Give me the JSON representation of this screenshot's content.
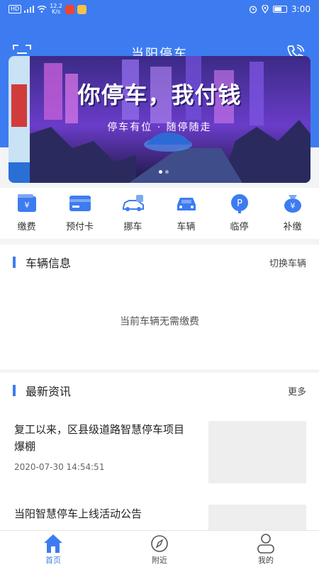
{
  "status_bar": {
    "network_chip": "HD",
    "speed_value": "12.2",
    "speed_unit": "K/s",
    "time": "3:00"
  },
  "header": {
    "title": "当阳停车"
  },
  "banner": {
    "headline": "你停车，我付钱",
    "subline": "停车有位 · 随停随走"
  },
  "quick_actions": [
    {
      "label": "缴费",
      "icon": "wallet-icon"
    },
    {
      "label": "预付卡",
      "icon": "card-icon"
    },
    {
      "label": "挪车",
      "icon": "move-car-icon"
    },
    {
      "label": "车辆",
      "icon": "car-icon"
    },
    {
      "label": "临停",
      "icon": "parking-icon"
    },
    {
      "label": "补缴",
      "icon": "money-bag-icon"
    }
  ],
  "vehicle_card": {
    "title": "车辆信息",
    "switch_label": "切换车辆",
    "empty_text": "当前车辆无需缴费"
  },
  "news_card": {
    "title": "最新资讯",
    "more_label": "更多",
    "items": [
      {
        "title": "复工以来，区县级道路智慧停车项目爆棚",
        "time": "2020-07-30 14:54:51"
      },
      {
        "title": "当阳智慧停车上线活动公告",
        "time": ""
      }
    ]
  },
  "tabbar": {
    "tabs": [
      {
        "label": "首页",
        "icon": "home-icon",
        "active": true
      },
      {
        "label": "附近",
        "icon": "compass-icon",
        "active": false
      },
      {
        "label": "我的",
        "icon": "user-icon",
        "active": false
      }
    ]
  },
  "colors": {
    "primary": "#3d7cf0",
    "background": "#f3f4f6"
  }
}
